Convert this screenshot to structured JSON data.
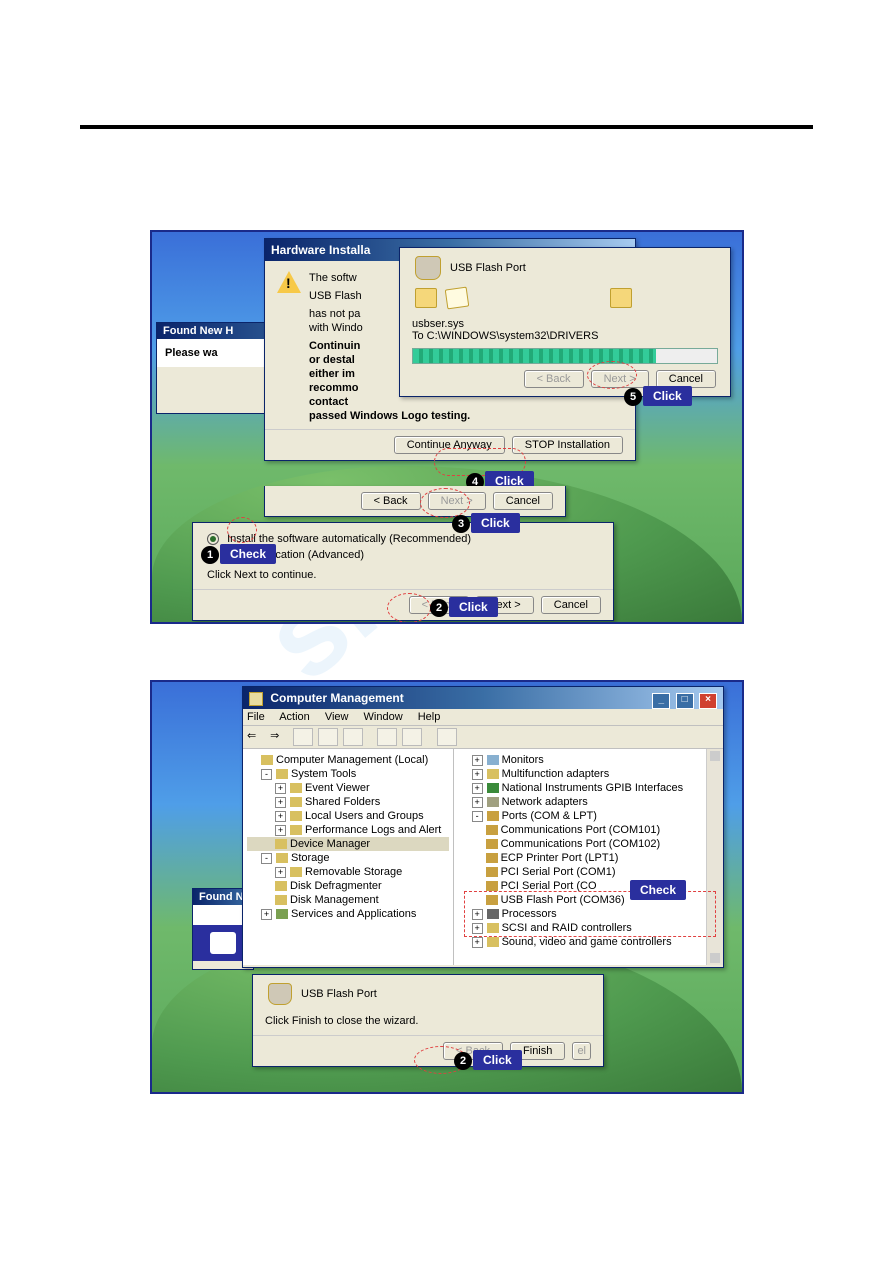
{
  "annotations": {
    "click": "Click",
    "check": "Check"
  },
  "bubbles": {
    "b1": "1",
    "b2": "2",
    "b3": "3",
    "b4": "4",
    "b5": "5"
  },
  "shot1": {
    "found_new": {
      "title": "Found New H",
      "please_wait": "Please wa"
    },
    "wizard_bottom": {
      "radio_auto": "Install the software automatically (Recommended)",
      "radio_specific_suffix": "  specific location (Advanced)",
      "click_next": "Click Next to continue.",
      "back": "< Back",
      "next": "Next >",
      "cancel": "Cancel"
    },
    "hw_install": {
      "title": "Hardware Installa",
      "line1": "The softw",
      "line2": "USB Flash",
      "line3": "has not pa",
      "line4": "with Windo",
      "line5a": "Continuin",
      "line5b": "or destal",
      "line5c": "either im",
      "line5d": "recommo",
      "line5e": "contact",
      "line6": "passed Windows Logo testing.",
      "continue": "Continue Anyway",
      "stop": "STOP Installation"
    },
    "copy_panel": {
      "device": "USB Flash Port",
      "file": "usbser.sys",
      "dest": "To C:\\WINDOWS\\system32\\DRIVERS",
      "back": "< Back",
      "next": "Next >",
      "cancel": "Cancel",
      "progress_pct": 80
    },
    "mid_nav": {
      "back": "< Back",
      "next": "Next >",
      "cancel": "Cancel"
    }
  },
  "shot2": {
    "found_n": {
      "title": "Found N"
    },
    "cm": {
      "title": "Computer Management",
      "menu": {
        "file": "File",
        "action": "Action",
        "view": "View",
        "window": "Window",
        "help": "Help"
      },
      "left": {
        "root": "Computer Management (Local)",
        "system_tools": "System Tools",
        "event_viewer": "Event Viewer",
        "shared_folders": "Shared Folders",
        "local_users": "Local Users and Groups",
        "perf": "Performance Logs and Alert",
        "device_mgr": "Device Manager",
        "storage": "Storage",
        "removable": "Removable Storage",
        "defrag": "Disk Defragmenter",
        "diskmgmt": "Disk Management",
        "services": "Services and Applications"
      },
      "right": {
        "monitors": "Monitors",
        "multifunction": "Multifunction adapters",
        "ni_gpib": "National Instruments GPIB Interfaces",
        "network": "Network adapters",
        "ports": "Ports (COM & LPT)",
        "com101": "Communications Port (COM101)",
        "com102": "Communications Port (COM102)",
        "ecp": "ECP Printer Port (LPT1)",
        "pci1": "PCI Serial Port (COM1)",
        "pci_cut": "PCI Serial Port (CO",
        "usb_flash": "USB Flash Port (COM36)",
        "processors": "Processors",
        "scsi": "SCSI and RAID controllers",
        "sound": "Sound, video and game controllers"
      }
    },
    "finish_panel": {
      "device": "USB Flash Port",
      "instruction": "Click Finish to close the wizard.",
      "back": "< Back",
      "finish": "Finish",
      "cancel_cut": "el"
    }
  }
}
